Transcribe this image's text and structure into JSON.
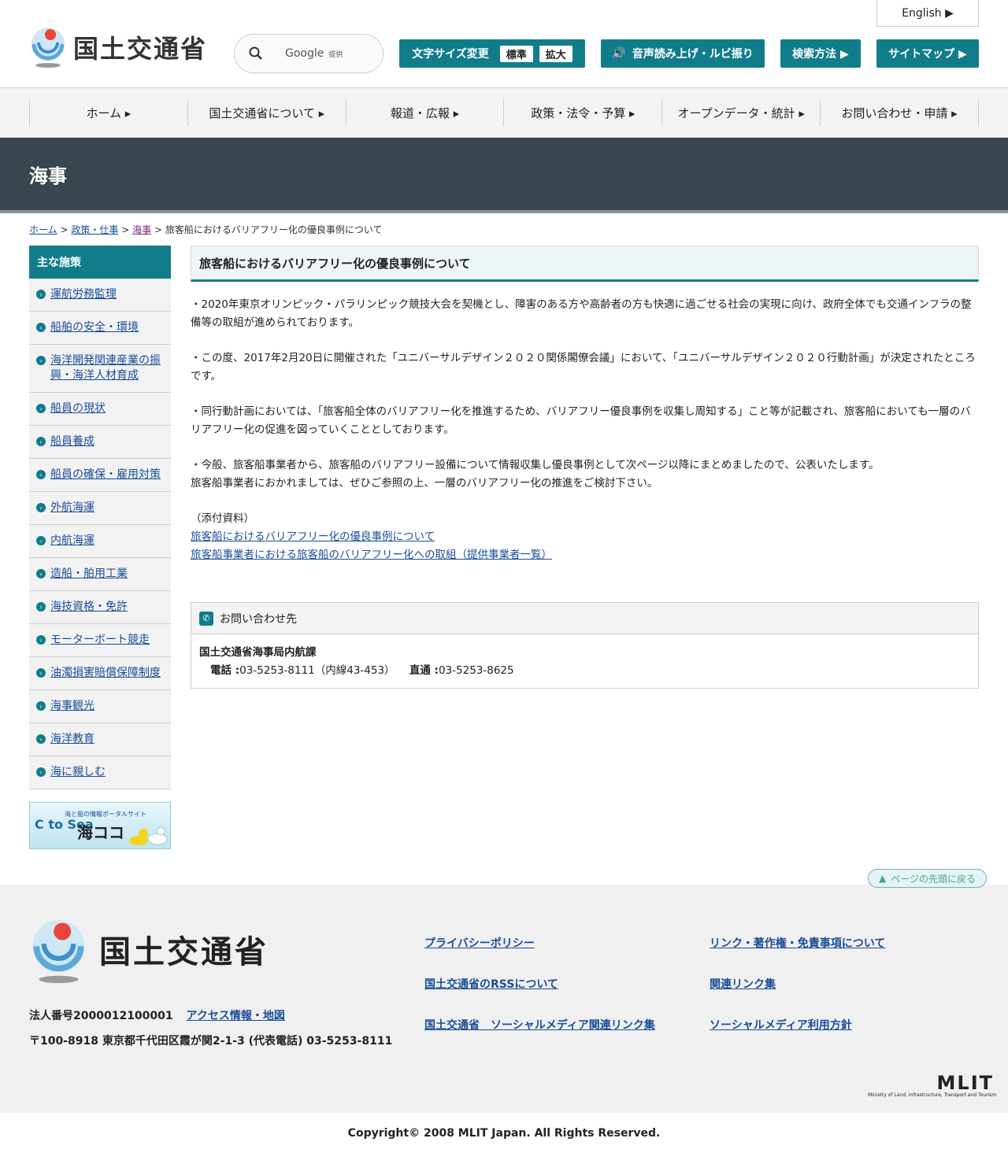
{
  "header": {
    "site_title": "国土交通省",
    "search_provider": "Google",
    "search_suffix": "提供",
    "font_size_label": "文字サイズ変更",
    "font_standard": "標準",
    "font_large": "拡大",
    "voice_label": "音声読み上げ・ルビ振り",
    "search_method": "検索方法 ▶",
    "sitemap": "サイトマップ ▶",
    "english": "English ▶"
  },
  "gnav": [
    "ホーム ▸",
    "国土交通省について ▸",
    "報道・広報 ▸",
    "政策・法令・予算 ▸",
    "オープンデータ・統計 ▸",
    "お問い合わせ・申請 ▸"
  ],
  "section_title": "海事",
  "breadcrumb": {
    "home": "ホーム",
    "policy": "政策・仕事",
    "maritime": "海事",
    "current": "旅客船におけるバリアフリー化の優良事例について",
    "sep": ">"
  },
  "sidebar": {
    "heading": "主な施策",
    "items": [
      "運航労務監理",
      "船舶の安全・環境",
      "海洋開発関連産業の振興・海洋人材育成",
      "船員の現状",
      "船員養成",
      "船員の確保・雇用対策",
      "外航海運",
      "内航海運",
      "造船・舶用工業",
      "海技資格・免許",
      "モーターボート競走",
      "油濁損害賠償保障制度",
      "海事観光",
      "海洋教育",
      "海に親しむ"
    ],
    "banner_caption": "海と船の情報ポータルサイト",
    "banner_tosea": "C to Sea",
    "banner_name": "海ココ"
  },
  "main": {
    "title": "旅客船におけるバリアフリー化の優良事例について",
    "p1": "・2020年東京オリンピック・パラリンピック競技大会を契機とし、障害のある方や高齢者の方も快適に過ごせる社会の実現に向け、政府全体でも交通インフラの整備等の取組が進められております。",
    "p2": "・この度、2017年2月20日に開催された「ユニバーサルデザイン２０２０関係閣僚会議」において、「ユニバーサルデザイン２０２０行動計画」が決定されたところです。",
    "p3": "・同行動計画においては、「旅客船全体のバリアフリー化を推進するため、バリアフリー優良事例を収集し周知する」こと等が記載され、旅客船においても一層のバリアフリー化の促進を図っていくこととしております。",
    "p4a": "・今般、旅客船事業者から、旅客船のバリアフリー設備について情報収集し優良事例として次ページ以降にまとめましたので、公表いたします。",
    "p4b": "旅客船事業者におかれましては、ぜひご参照の上、一層のバリアフリー化の推進をご検討下さい。",
    "attach_label": "（添付資料）",
    "attach1": "旅客船におけるバリアフリー化の優良事例について",
    "attach2": "旅客船事業者における旅客船のバリアフリー化への取組（提供事業者一覧）"
  },
  "contact": {
    "heading": "お問い合わせ先",
    "dept": "国土交通省海事局内航課",
    "tel_label": "電話 :",
    "tel": "03-5253-8111（内線43-453）",
    "direct_label": "直通 :",
    "direct": "03-5253-8625"
  },
  "pagetop": "ページの先頭に戻る",
  "footer": {
    "site_title": "国土交通省",
    "corp_no": "法人番号2000012100001",
    "access": "アクセス情報・地図",
    "address": "〒100-8918 東京都千代田区霞が関2-1-3 (代表電話) 03-5253-8111",
    "links": [
      "プライバシーポリシー",
      "リンク・著作権・免責事項について",
      "国土交通省のRSSについて",
      "関連リンク集",
      "国土交通省　ソーシャルメディア関連リンク集",
      "ソーシャルメディア利用方針"
    ],
    "mlit": "MLIT",
    "mlit_sub": "Ministry of Land, Infrastructure, Transport and Tourism",
    "copyright": "Copyright© 2008 MLIT Japan. All Rights Reserved."
  },
  "colors": {
    "accent": "#117d8b",
    "band": "#3a464d",
    "link": "#1a4d99"
  }
}
